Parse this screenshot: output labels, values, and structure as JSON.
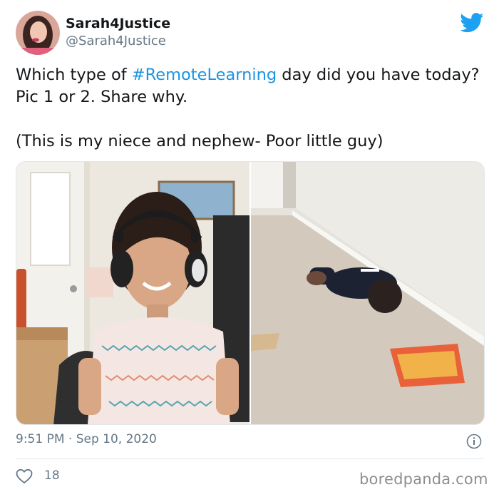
{
  "user": {
    "display_name": "Sarah4Justice",
    "handle": "@Sarah4Justice"
  },
  "icons": {
    "brand": "twitter-bird-icon",
    "info": "info-icon",
    "like": "heart-icon"
  },
  "tweet": {
    "line1_prefix": "Which type of ",
    "hashtag": "#RemoteLearning",
    "line1_suffix": " day did you have today? Pic 1 or 2. Share why.",
    "paragraph2": "(This is my niece and nephew- Poor little guy)"
  },
  "meta": {
    "time": "9:51 PM",
    "separator": " · ",
    "date": "Sep 10, 2020",
    "likes": "18"
  },
  "watermark": "boredpanda.com",
  "colors": {
    "twitter_blue": "#1da1f2",
    "hashtag": "#1b95e0",
    "muted_text": "#657786",
    "border": "#e1e8ed"
  }
}
